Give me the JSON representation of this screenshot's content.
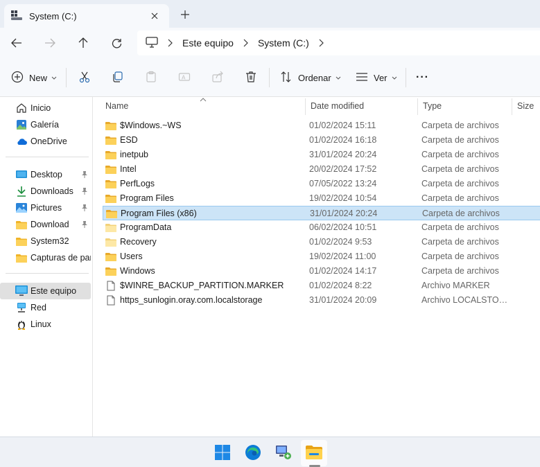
{
  "tab": {
    "title": "System (C:)"
  },
  "address": {
    "crumbs": [
      "Este equipo",
      "System (C:)"
    ]
  },
  "commands": {
    "new_label": "New",
    "sort_label": "Ordenar",
    "view_label": "Ver",
    "more_label": "···"
  },
  "sidebar": {
    "quick": [
      {
        "label": "Inicio",
        "icon": "home-icon"
      },
      {
        "label": "Galería",
        "icon": "gallery-icon"
      },
      {
        "label": "OneDrive",
        "icon": "cloud-icon"
      }
    ],
    "pinned": [
      {
        "label": "Desktop",
        "icon": "desktop-icon",
        "pinned": true
      },
      {
        "label": "Downloads",
        "icon": "download-arrow-icon",
        "pinned": true
      },
      {
        "label": "Pictures",
        "icon": "pictures-icon",
        "pinned": true
      },
      {
        "label": "Download",
        "icon": "folder-icon",
        "pinned": true
      },
      {
        "label": "System32",
        "icon": "folder-icon",
        "pinned": false
      },
      {
        "label": "Capturas de pantalla",
        "icon": "folder-icon",
        "pinned": false
      }
    ],
    "locations": [
      {
        "label": "Este equipo",
        "icon": "computer-icon",
        "selected": true
      },
      {
        "label": "Red",
        "icon": "network-icon"
      },
      {
        "label": "Linux",
        "icon": "linux-icon"
      }
    ]
  },
  "columns": {
    "name": "Name",
    "date": "Date modified",
    "type": "Type",
    "size": "Size"
  },
  "files": [
    {
      "name": "$Windows.~WS",
      "date": "01/02/2024 15:11",
      "type": "Carpeta de archivos",
      "kind": "folder"
    },
    {
      "name": "ESD",
      "date": "01/02/2024 16:18",
      "type": "Carpeta de archivos",
      "kind": "folder"
    },
    {
      "name": "inetpub",
      "date": "31/01/2024 20:24",
      "type": "Carpeta de archivos",
      "kind": "folder"
    },
    {
      "name": "Intel",
      "date": "20/02/2024 17:52",
      "type": "Carpeta de archivos",
      "kind": "folder"
    },
    {
      "name": "PerfLogs",
      "date": "07/05/2022 13:24",
      "type": "Carpeta de archivos",
      "kind": "folder"
    },
    {
      "name": "Program Files",
      "date": "19/02/2024 10:54",
      "type": "Carpeta de archivos",
      "kind": "folder"
    },
    {
      "name": "Program Files (x86)",
      "date": "31/01/2024 20:24",
      "type": "Carpeta de archivos",
      "kind": "folder",
      "selected": true
    },
    {
      "name": "ProgramData",
      "date": "06/02/2024 10:51",
      "type": "Carpeta de archivos",
      "kind": "folder-light"
    },
    {
      "name": "Recovery",
      "date": "01/02/2024 9:53",
      "type": "Carpeta de archivos",
      "kind": "folder-light"
    },
    {
      "name": "Users",
      "date": "19/02/2024 11:00",
      "type": "Carpeta de archivos",
      "kind": "folder"
    },
    {
      "name": "Windows",
      "date": "01/02/2024 14:17",
      "type": "Carpeta de archivos",
      "kind": "folder"
    },
    {
      "name": "$WINRE_BACKUP_PARTITION.MARKER",
      "date": "01/02/2024 8:22",
      "type": "Archivo MARKER",
      "kind": "file"
    },
    {
      "name": "https_sunlogin.oray.com.localstorage",
      "date": "31/01/2024 20:09",
      "type": "Archivo LOCALSTORAGE",
      "kind": "file"
    }
  ],
  "taskbar": {
    "apps": [
      {
        "name": "start",
        "icon": "windows-logo-icon"
      },
      {
        "name": "edge",
        "icon": "edge-browser-icon"
      },
      {
        "name": "network-tool",
        "icon": "network-computer-icon"
      },
      {
        "name": "file-explorer",
        "icon": "file-explorer-icon",
        "active": true
      }
    ]
  },
  "colors": {
    "accent": "#0067c0",
    "folder": "#f7c34c",
    "selection": "#cce4f7"
  }
}
